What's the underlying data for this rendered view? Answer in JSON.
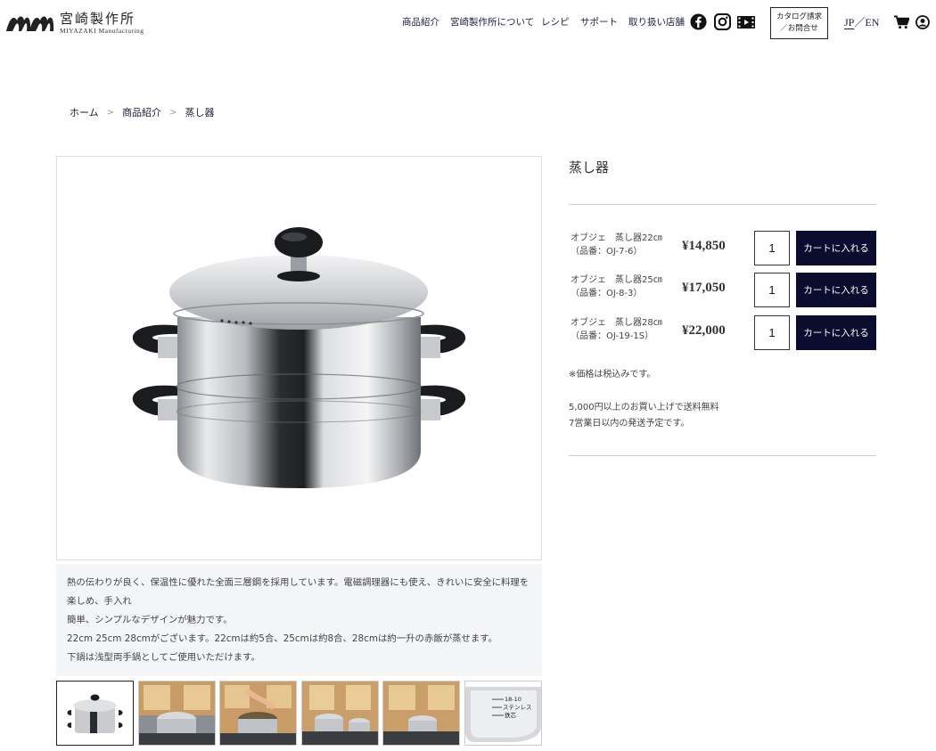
{
  "brand": {
    "name_jp": "宮崎製作所",
    "name_en": "MIYAZAKI Manufacturing"
  },
  "nav": {
    "items": [
      {
        "label": "商品紹介"
      },
      {
        "label": "宮崎製作所について"
      },
      {
        "label": "レシピ"
      },
      {
        "label": "サポート"
      },
      {
        "label": "取り扱い店舗"
      }
    ],
    "catalog_line1": "カタログ請求",
    "catalog_line2": "／お問合せ",
    "lang_jp": "JP",
    "lang_sep": "／",
    "lang_en": "EN",
    "icons": [
      "facebook-icon",
      "instagram-icon",
      "video-icon",
      "cart-icon",
      "account-icon"
    ]
  },
  "breadcrumb": {
    "home": "ホーム",
    "sep": ">",
    "category": "商品紹介",
    "current": "蒸し器"
  },
  "product": {
    "title": "蒸し器",
    "variants": [
      {
        "name": "オブジェ　蒸し器22㎝",
        "code": "（品番：OJ-7-6）",
        "price": "¥14,850",
        "qty": "1",
        "button": "カートに入れる"
      },
      {
        "name": "オブジェ　蒸し器25㎝",
        "code": "（品番：OJ-8-3）",
        "price": "¥17,050",
        "qty": "1",
        "button": "カートに入れる"
      },
      {
        "name": "オブジェ　蒸し器28㎝",
        "code": "（品番：OJ-19-1S）",
        "price": "¥22,000",
        "qty": "1",
        "button": "カートに入れる"
      }
    ],
    "tax_note": "※価格は税込みです。",
    "shipping_note1": "5,000円以上のお買い上げで送料無料",
    "shipping_note2": "7営業日以内の発送予定です。",
    "description": [
      "熱の伝わりが良く、保温性に優れた全面三層鋼を採用しています。電磁調理器にも使え、きれいに安全に料理を楽しめ、手入れ",
      "簡単、シンプルなデザインが魅力です。",
      "22cm 25cm 28cmがございます。22cmは約5合、25cmは約8合、28cmは約一升の赤飯が蒸せます。",
      "下鍋は浅型両手鍋としてご使用いただけます。"
    ],
    "thumb_label_line1": "18-10",
    "thumb_label_line2": "ステンレス",
    "thumb_label_line3": "鉄芯"
  },
  "colors": {
    "accent": "#0b0c2e",
    "nav_text": "#1a1f3a",
    "desc_bg": "#f4f5f7"
  }
}
